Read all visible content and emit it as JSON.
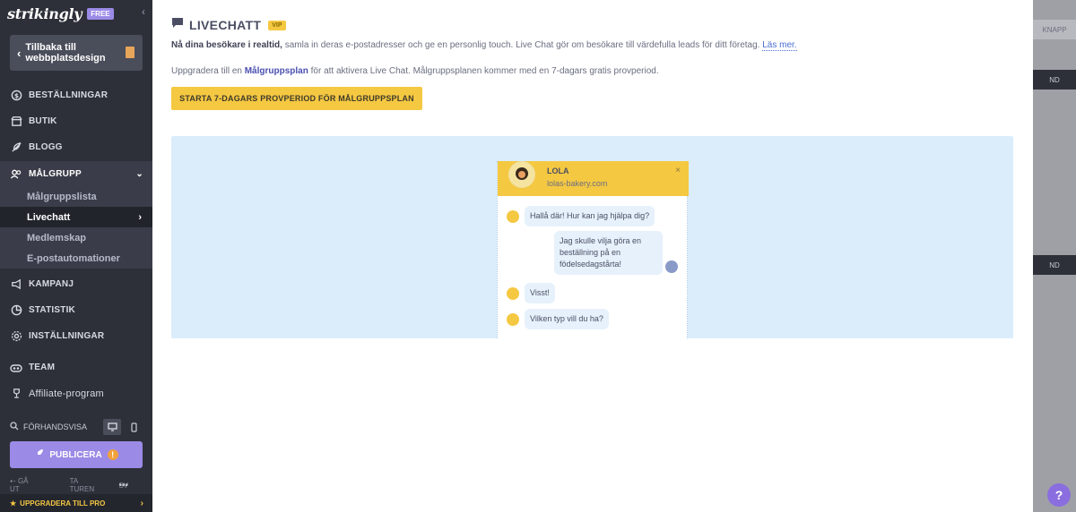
{
  "sidebar": {
    "brand": "strikingly",
    "badge": "FREE",
    "back_label": "Tillbaka till webbplatsdesign",
    "nav": {
      "orders": "BESTÄLLNINGAR",
      "store": "BUTIK",
      "blog": "BLOGG",
      "audience": "MÅLGRUPP",
      "campaign": "KAMPANJ",
      "stats": "STATISTIK",
      "settings": "INSTÄLLNINGAR",
      "team": "TEAM",
      "affiliate": "Affiliate-program"
    },
    "sub": {
      "list": "Målgruppslista",
      "livechat": "Livechatt",
      "membership": "Medlemskap",
      "email_automation": "E-postautomationer"
    },
    "preview_label": "FÖRHANDSVISA",
    "publish_label": "PUBLICERA",
    "bottom_links": [
      "GÅ UT",
      "TA TUREN",
      "SV"
    ],
    "upgrade_label": "UPPGRADERA TILL PRO"
  },
  "main": {
    "title": "LIVECHATT",
    "vip": "VIP",
    "desc_bold": "Nå dina besökare i realtid,",
    "desc_rest": " samla in deras e-postadresser och ge en personlig touch. Live Chat gör om besökare till värdefulla leads för ditt företag.",
    "desc_link": "Läs mer.",
    "upgrade_pre": "Uppgradera till en ",
    "upgrade_bold": "Målgruppsplan",
    "upgrade_post": " för att aktivera Live Chat. Målgruppsplanen kommer med en 7-dagars gratis provperiod.",
    "trial_button": "STARTA 7-DAGARS PROVPERIOD FÖR MÅLGRUPPSPLAN"
  },
  "chat": {
    "name": "LOLA",
    "domain": "lolas-bakery.com",
    "messages": [
      {
        "from": "agent",
        "text": "Hallå där! Hur kan jag hjälpa dig?"
      },
      {
        "from": "user",
        "text": "Jag skulle vilja göra en beställning på en födelsedagstårta!"
      },
      {
        "from": "agent",
        "text": "Visst!"
      },
      {
        "from": "agent",
        "text": "Vilken typ vill du ha?"
      }
    ]
  },
  "overlay": {
    "ghost_button": "KNAPP",
    "ghost_send": "ND"
  },
  "icons": {
    "accent": "#9b8ae6",
    "yellow": "#f5c842",
    "sidebar_bg": "#2e3039"
  }
}
